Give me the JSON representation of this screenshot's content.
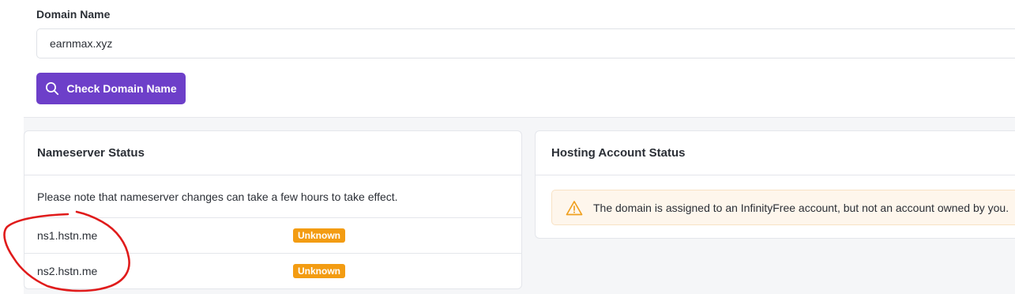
{
  "domain_form": {
    "label": "Domain Name",
    "value": "earnmax.xyz",
    "check_button_label": "Check Domain Name"
  },
  "nameserver_card": {
    "title": "Nameserver Status",
    "note": "Please note that nameserver changes can take a few hours to take effect.",
    "rows": [
      {
        "name": "ns1.hstn.me",
        "status": "Unknown"
      },
      {
        "name": "ns2.hstn.me",
        "status": "Unknown"
      }
    ]
  },
  "hosting_card": {
    "title": "Hosting Account Status",
    "alert_text": "The domain is assigned to an InfinityFree account, but not an account owned by you."
  },
  "colors": {
    "accent": "#6d3fc9",
    "badge_unknown": "#f39c12",
    "alert_background": "#fef6ec",
    "alert_icon": "#f0a020",
    "annotation": "#e01b1b"
  },
  "icons": {
    "button_icon": "search-icon",
    "alert_icon": "warning-triangle-icon"
  }
}
